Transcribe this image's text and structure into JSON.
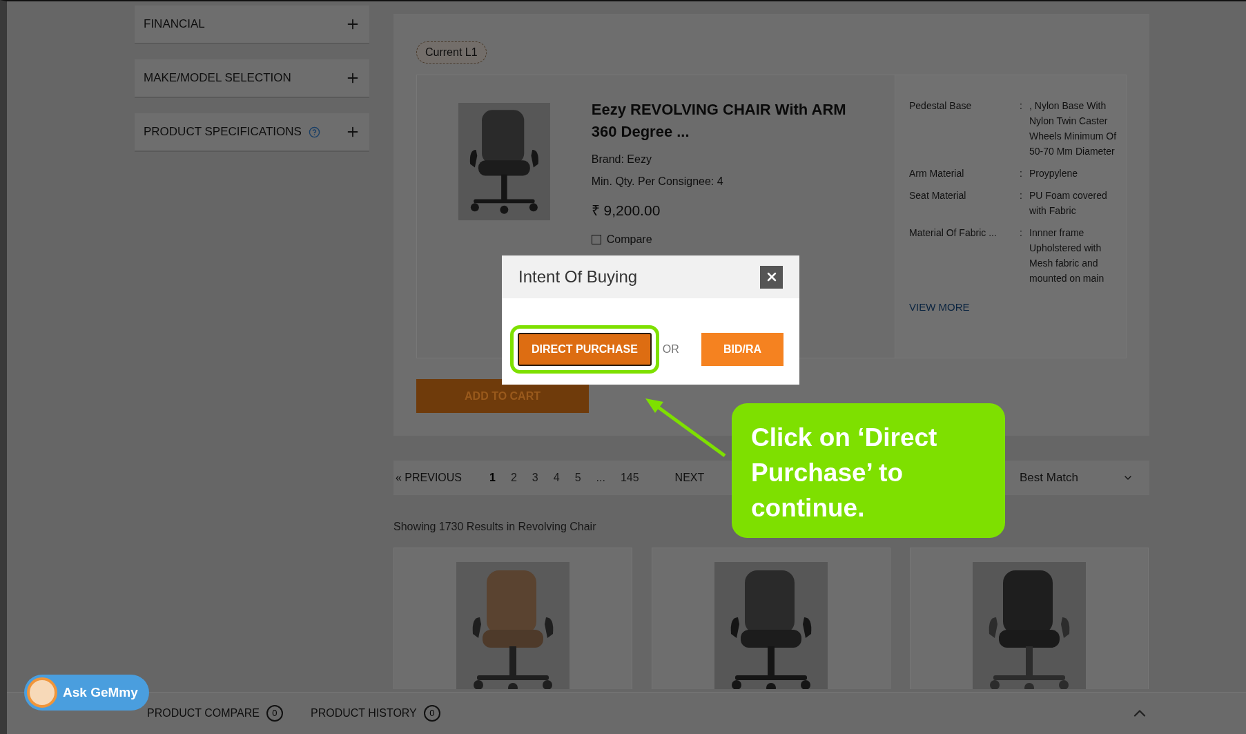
{
  "sidebar": {
    "sections": [
      {
        "label": "FINANCIAL",
        "help": false
      },
      {
        "label": "MAKE/MODEL SELECTION",
        "help": false
      },
      {
        "label": "PRODUCT SPECIFICATIONS",
        "help": true
      }
    ]
  },
  "product": {
    "badge": "Current L1",
    "title": "Eezy REVOLVING CHAIR With ARM 360 Degree ...",
    "brand": "Brand: Eezy",
    "min_qty": "Min. Qty. Per Consignee: 4",
    "price": "₹ 9,200.00",
    "compare": {
      "label": "Compare",
      "checked": false
    },
    "specs": [
      {
        "label": "Pedestal Base",
        "separator": ":",
        "value": ", Nylon Base With Nylon Twin Caster Wheels Minimum Of 50-70 Mm Diameter"
      },
      {
        "label": "Arm Material",
        "separator": ":",
        "value": "Proypylene"
      },
      {
        "label": "Seat Material",
        "separator": ":",
        "value": "PU Foam covered with Fabric"
      },
      {
        "label": "Material Of Fabric ...",
        "separator": ":",
        "value": "Innner frame Upholstered with Mesh fabric and mounted on main"
      }
    ],
    "view_more": "VIEW MORE",
    "add_to_cart": "ADD TO CART"
  },
  "pagination": {
    "previous": "« PREVIOUS",
    "pages": [
      {
        "label": "1",
        "selected": true
      },
      {
        "label": "2",
        "selected": false
      },
      {
        "label": "3",
        "selected": false
      },
      {
        "label": "4",
        "selected": false
      },
      {
        "label": "5",
        "selected": false
      },
      {
        "label": "...",
        "selected": false
      },
      {
        "label": "145",
        "selected": false
      }
    ],
    "next": "NEXT",
    "sort": "Best Match"
  },
  "results": "Showing 1730 Results in Revolving Chair",
  "bottom_bar": {
    "items": [
      {
        "label": "PRODUCT COMPARE",
        "count": "0"
      },
      {
        "label": "PRODUCT HISTORY",
        "count": "0"
      }
    ]
  },
  "assistant": {
    "label": "Ask GeMmy"
  },
  "modal": {
    "title": "Intent Of Buying",
    "buttons": [
      {
        "label": "DIRECT PURCHASE",
        "highlighted": true
      },
      {
        "label": "BID/RA",
        "highlighted": false
      }
    ],
    "separator": "OR"
  },
  "callout": {
    "text": "Click on ‘Direct Purchase’ to continue."
  }
}
